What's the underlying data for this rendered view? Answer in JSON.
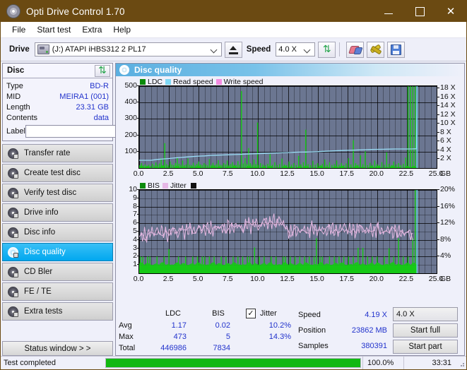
{
  "window": {
    "title": "Opti Drive Control 1.70",
    "app_icon": "disc-icon",
    "minimize": "–",
    "maximize": "□",
    "close": "✕",
    "titlebar_color": "#6b4a12"
  },
  "menu": {
    "items": [
      "File",
      "Start test",
      "Extra",
      "Help"
    ]
  },
  "toolbar": {
    "drive_label": "Drive",
    "drive_value": "(J:)  ATAPI iHBS312  2 PL17",
    "eject_icon": "eject-icon",
    "speed_label": "Speed",
    "speed_value": "4.0 X",
    "refresh_icon": "refresh-icon",
    "erase_icon": "eraser-icon",
    "tools_icon": "tools-icon",
    "save_icon": "save-icon"
  },
  "disc_panel": {
    "title": "Disc",
    "refresh_icon": "refresh-icon",
    "rows": [
      {
        "key": "Type",
        "value": "BD-R"
      },
      {
        "key": "MID",
        "value": "MEIRA1 (001)"
      },
      {
        "key": "Length",
        "value": "23.31 GB"
      },
      {
        "key": "Contents",
        "value": "data"
      }
    ],
    "label_key": "Label",
    "label_value": "",
    "label_placeholder": "",
    "label_button_icon": "cd-icon"
  },
  "sidebar": {
    "items": [
      {
        "label": "Transfer rate",
        "icon": "disc-icon",
        "active": false
      },
      {
        "label": "Create test disc",
        "icon": "disc-icon",
        "active": false
      },
      {
        "label": "Verify test disc",
        "icon": "disc-icon",
        "active": false
      },
      {
        "label": "Drive info",
        "icon": "disc-icon",
        "active": false
      },
      {
        "label": "Disc info",
        "icon": "disc-icon",
        "active": false
      },
      {
        "label": "Disc quality",
        "icon": "disc-icon",
        "active": true
      },
      {
        "label": "CD Bler",
        "icon": "disc-icon",
        "active": false
      },
      {
        "label": "FE / TE",
        "icon": "disc-icon",
        "active": false
      },
      {
        "label": "Extra tests",
        "icon": "disc-icon",
        "active": false
      }
    ],
    "status_window_button": "Status window > >"
  },
  "panel": {
    "header_title": "Disc quality",
    "header_icon": "disc-icon"
  },
  "chart_data": [
    {
      "type": "area",
      "name": "ldc-chart",
      "title": "",
      "xlabel": "GB",
      "ylabel": "",
      "xlim": [
        0,
        25
      ],
      "ylim": [
        0,
        500
      ],
      "y2lim": [
        0,
        18.5
      ],
      "xticks": [
        "0.0",
        "2.5",
        "5.0",
        "7.5",
        "10.0",
        "12.5",
        "15.0",
        "17.5",
        "20.0",
        "22.5",
        "25.0"
      ],
      "yticks": [
        "100",
        "200",
        "300",
        "400",
        "500"
      ],
      "y2ticks": [
        "2 X",
        "4 X",
        "6 X",
        "8 X",
        "10 X",
        "12 X",
        "14 X",
        "16 X",
        "18 X"
      ],
      "xunit": "GB",
      "grid": true,
      "legend": [
        {
          "label": "LDC",
          "color": "#0a8a0a"
        },
        {
          "label": "Read speed",
          "color": "#7fd8f5"
        },
        {
          "label": "Write speed",
          "color": "#f48ce0"
        }
      ],
      "series": [
        {
          "name": "LDC",
          "color": "#16c916",
          "type": "spikes",
          "x": [
            0.05,
            0.2,
            0.35,
            0.5,
            0.65,
            0.8,
            0.95,
            1.1,
            1.25,
            1.4,
            1.55,
            1.7,
            1.85,
            2.0,
            2.15,
            2.3,
            2.45,
            2.6,
            2.75,
            2.9,
            3.05,
            3.2,
            3.35,
            3.5,
            3.65,
            3.8,
            3.95,
            4.1,
            4.25,
            4.4,
            4.55,
            4.7,
            4.85,
            5.0,
            5.15,
            5.3,
            5.45,
            5.6,
            5.75,
            5.9,
            6.05,
            6.2,
            6.35,
            6.5,
            6.65,
            6.8,
            6.95,
            7.1,
            7.25,
            7.4,
            7.55,
            7.7,
            7.85,
            8.0,
            8.15,
            8.3,
            8.45,
            8.6,
            8.75,
            8.9,
            9.05,
            9.2,
            9.35,
            9.5,
            9.65,
            9.8,
            9.95,
            10.05,
            10.2,
            10.4,
            10.6,
            10.8,
            11.0,
            11.2,
            11.4,
            11.6,
            11.8,
            12.0,
            12.2,
            12.4,
            12.6,
            12.8,
            13.0,
            13.2,
            13.4,
            13.6,
            13.8,
            14.0,
            14.2,
            14.4,
            14.6,
            14.8,
            15.0,
            15.2,
            15.4,
            15.6,
            15.8,
            16.0,
            16.2,
            16.4,
            16.6,
            16.8,
            17.0,
            17.2,
            17.4,
            17.6,
            17.8,
            18.0,
            18.2,
            18.4,
            18.6,
            18.8,
            19.0,
            19.2,
            19.4,
            19.6,
            19.8,
            20.0,
            20.2,
            20.4,
            20.6,
            20.8,
            21.0,
            21.2,
            21.4,
            21.6,
            21.8,
            22.0,
            22.2,
            22.4,
            22.6,
            22.8,
            23.0,
            23.2,
            23.35
          ],
          "values": [
            18,
            30,
            16,
            22,
            14,
            20,
            12,
            26,
            16,
            34,
            20,
            28,
            60,
            18,
            152,
            24,
            16,
            40,
            22,
            18,
            30,
            62,
            26,
            20,
            46,
            18,
            22,
            58,
            20,
            18,
            32,
            18,
            26,
            40,
            22,
            18,
            30,
            22,
            16,
            54,
            20,
            32,
            18,
            24,
            48,
            20,
            18,
            30,
            22,
            46,
            18,
            24,
            36,
            20,
            18,
            42,
            20,
            470,
            28,
            60,
            24,
            122,
            30,
            20,
            52,
            24,
            278,
            18,
            30,
            22,
            18,
            26,
            84,
            20,
            36,
            18,
            24,
            58,
            22,
            18,
            40,
            20,
            30,
            18,
            74,
            22,
            36,
            234,
            24,
            18,
            44,
            20,
            30,
            18,
            26,
            52,
            20,
            36,
            18,
            24,
            46,
            20,
            30,
            18,
            28,
            60,
            22,
            170,
            30,
            20,
            78,
            24,
            102,
            18,
            32,
            20,
            46,
            24,
            18,
            36,
            20,
            96,
            26,
            18,
            40,
            22,
            30,
            18,
            26,
            64,
            500
          ]
        },
        {
          "name": "Read speed",
          "color": "#9adcf5",
          "type": "line",
          "x": [
            0.0,
            0.5,
            1.0,
            1.5,
            2.0,
            2.5,
            3.0,
            3.5,
            4.0,
            4.5,
            5.0,
            5.5,
            6.0,
            6.5,
            7.0,
            7.5,
            8.0,
            8.5,
            9.0,
            9.5,
            10.0,
            10.5,
            11.0,
            11.5,
            12.0,
            12.5,
            13.0,
            13.5,
            14.0,
            14.5,
            15.0,
            15.5,
            16.0,
            16.5,
            17.0,
            17.5,
            18.0,
            18.5,
            19.0,
            19.5,
            20.0,
            20.5,
            21.0,
            21.5,
            22.0,
            22.5,
            23.0,
            23.3,
            23.35
          ],
          "values": [
            1.75,
            1.75,
            1.75,
            1.95,
            2.05,
            2.15,
            2.3,
            2.4,
            2.5,
            2.6,
            2.7,
            2.75,
            2.85,
            2.9,
            2.95,
            3.0,
            3.05,
            3.1,
            3.15,
            3.2,
            3.25,
            3.3,
            3.35,
            3.4,
            3.45,
            3.5,
            3.55,
            3.6,
            3.62,
            3.65,
            3.7,
            3.78,
            3.85,
            3.9,
            3.95,
            4.0,
            4.05,
            4.1,
            4.15,
            4.2,
            4.22,
            4.25,
            4.28,
            4.3,
            4.3,
            4.3,
            4.32,
            4.35,
            18.5
          ]
        }
      ]
    },
    {
      "type": "area",
      "name": "bis-jitter-chart",
      "title": "",
      "xlabel": "GB",
      "ylabel": "",
      "xlim": [
        0,
        25
      ],
      "ylim": [
        0,
        10
      ],
      "y2lim": [
        0,
        20
      ],
      "xticks": [
        "0.0",
        "2.5",
        "5.0",
        "7.5",
        "10.0",
        "12.5",
        "15.0",
        "17.5",
        "20.0",
        "22.5",
        "25.0"
      ],
      "yticks": [
        "1",
        "2",
        "3",
        "4",
        "5",
        "6",
        "7",
        "8",
        "9",
        "10"
      ],
      "y2ticks": [
        "4%",
        "8%",
        "12%",
        "16%",
        "20%"
      ],
      "xunit": "GB",
      "grid": true,
      "legend": [
        {
          "label": "BIS",
          "color": "#0a8a0a"
        },
        {
          "label": "Jitter",
          "color": "#e6b8e6"
        }
      ],
      "series": [
        {
          "name": "BIS",
          "color": "#16c916",
          "type": "spikes",
          "baseline": 1,
          "x": [
            0.1,
            0.3,
            0.5,
            0.7,
            0.9,
            1.1,
            1.3,
            1.5,
            1.7,
            1.9,
            2.1,
            2.3,
            2.5,
            2.7,
            2.9,
            3.1,
            3.3,
            3.5,
            3.7,
            3.9,
            4.1,
            4.3,
            4.5,
            4.7,
            4.9,
            5.1,
            5.3,
            5.5,
            5.7,
            5.9,
            6.1,
            6.3,
            6.5,
            6.7,
            6.9,
            7.1,
            7.3,
            7.5,
            7.7,
            7.9,
            8.1,
            8.3,
            8.5,
            8.7,
            8.9,
            9.1,
            9.3,
            9.5,
            9.7,
            9.9,
            10.1,
            10.3,
            10.5,
            10.7,
            10.9,
            11.1,
            11.3,
            11.5,
            11.7,
            11.9,
            12.1,
            12.3,
            12.5,
            12.7,
            12.9,
            13.1,
            13.3,
            13.5,
            13.7,
            13.9,
            14.1,
            14.3,
            14.5,
            14.7,
            14.9,
            15.0,
            15.2,
            15.4,
            15.6,
            15.8,
            16.0,
            16.2,
            16.4,
            16.6,
            16.8,
            17.0,
            17.2,
            17.4,
            17.6,
            17.8,
            18.0,
            18.2,
            18.4,
            18.6,
            18.8,
            19.0,
            19.2,
            19.4,
            19.6,
            19.8,
            20.0,
            20.2,
            20.4,
            20.6,
            20.8,
            21.0,
            21.2,
            21.4,
            21.6,
            21.8,
            22.0,
            22.2,
            22.4,
            22.6,
            22.8,
            23.0,
            23.2,
            23.35
          ],
          "values": [
            2,
            2,
            1,
            2,
            2,
            1,
            1,
            2,
            1,
            1,
            2,
            1,
            2.9,
            1,
            1,
            1,
            2,
            1,
            1,
            2,
            1,
            1,
            2,
            1,
            2,
            1,
            2,
            2,
            1,
            2,
            1,
            2,
            1,
            1,
            2,
            1,
            2,
            1,
            1,
            2,
            1,
            2,
            1,
            2,
            1,
            2,
            2,
            1,
            3.1,
            1,
            2,
            1,
            2,
            1,
            1,
            2,
            1,
            2,
            1,
            1,
            2,
            2,
            1,
            2,
            1,
            2,
            1,
            2,
            1,
            2,
            1,
            2,
            1,
            2,
            4.2,
            1,
            2,
            2,
            1,
            1,
            2,
            1,
            2,
            1,
            2,
            1,
            2,
            1,
            2,
            1,
            2,
            1,
            3.05,
            1,
            3.05,
            1,
            2,
            1,
            2,
            1,
            2,
            1,
            1,
            2,
            1,
            3.0,
            1,
            2,
            1,
            4.2,
            1,
            2,
            1,
            2,
            1,
            4.2
          ]
        },
        {
          "name": "Jitter",
          "color": "#e3b7e0",
          "type": "line",
          "x": [
            0.0,
            0.25,
            0.5,
            0.75,
            1.0,
            1.25,
            1.5,
            1.75,
            2.0,
            2.25,
            2.5,
            2.75,
            3.0,
            3.25,
            3.5,
            3.75,
            4.0,
            4.25,
            4.5,
            4.75,
            5.0,
            5.25,
            5.5,
            5.75,
            6.0,
            6.25,
            6.5,
            6.75,
            7.0,
            7.25,
            7.5,
            7.75,
            8.0,
            8.25,
            8.5,
            8.75,
            9.0,
            9.25,
            9.5,
            9.75,
            10.0,
            10.25,
            10.5,
            10.75,
            11.0,
            11.25,
            11.5,
            11.75,
            12.0,
            12.25,
            12.5,
            12.75,
            13.0,
            13.25,
            13.5,
            13.75,
            14.0,
            14.25,
            14.5,
            14.75,
            15.0,
            15.25,
            15.5,
            15.75,
            16.0,
            16.25,
            16.5,
            16.75,
            17.0,
            17.25,
            17.5,
            17.75,
            18.0,
            18.25,
            18.5,
            18.75,
            19.0,
            19.25,
            19.5,
            19.75,
            20.0,
            20.25,
            20.5,
            20.75,
            21.0,
            21.25,
            21.5,
            21.75,
            22.0,
            22.25,
            22.5,
            22.75,
            23.0
          ],
          "values": [
            4.05,
            4.35,
            4.6,
            4.75,
            4.9,
            4.7,
            4.85,
            4.95,
            5.0,
            4.85,
            4.65,
            5.0,
            5.15,
            5.0,
            5.3,
            5.05,
            5.2,
            5.15,
            5.3,
            5.2,
            5.35,
            5.2,
            5.4,
            5.3,
            5.45,
            5.3,
            5.4,
            5.35,
            5.5,
            5.4,
            5.55,
            5.45,
            5.6,
            5.5,
            5.7,
            5.55,
            5.75,
            5.9,
            5.8,
            5.95,
            5.85,
            5.9,
            6.0,
            5.95,
            6.15,
            6.3,
            6.05,
            6.2,
            5.9,
            5.6,
            5.15,
            5.0,
            5.1,
            5.05,
            5.2,
            5.1,
            5.25,
            5.15,
            5.3,
            5.2,
            5.35,
            5.2,
            5.25,
            5.15,
            5.3,
            5.2,
            5.25,
            5.15,
            5.3,
            5.2,
            5.25,
            5.15,
            5.3,
            5.2,
            5.3,
            5.2,
            5.3,
            5.15,
            5.25,
            5.1,
            5.2,
            5.1,
            5.2,
            5.05,
            5.15,
            5.0,
            5.05,
            4.95,
            5.0,
            4.85,
            4.75,
            4.6,
            4.5
          ]
        }
      ]
    }
  ],
  "stats": {
    "col_headers": [
      "",
      "LDC",
      "BIS",
      "Jitter"
    ],
    "rows": [
      {
        "label": "Avg",
        "ldc": "1.17",
        "bis": "0.02",
        "jitter": "10.2%"
      },
      {
        "label": "Max",
        "ldc": "473",
        "bis": "5",
        "jitter": "14.3%"
      },
      {
        "label": "Total",
        "ldc": "446986",
        "bis": "7834",
        "jitter": ""
      }
    ],
    "jitter_checkbox_label": "Jitter",
    "jitter_checked": true,
    "jitter_check_glyph": "✓",
    "speed_label": "Speed",
    "speed_value": "4.19 X",
    "position_label": "Position",
    "position_value": "23862 MB",
    "samples_label": "Samples",
    "samples_value": "380391",
    "speed_select_value": "4.0 X",
    "start_full_button": "Start full",
    "start_part_button": "Start part"
  },
  "statusbar": {
    "message": "Test completed",
    "progress_percent": "100.0%",
    "progress_value": 100,
    "elapsed": "33:31",
    "progress_color": "#12b812"
  }
}
